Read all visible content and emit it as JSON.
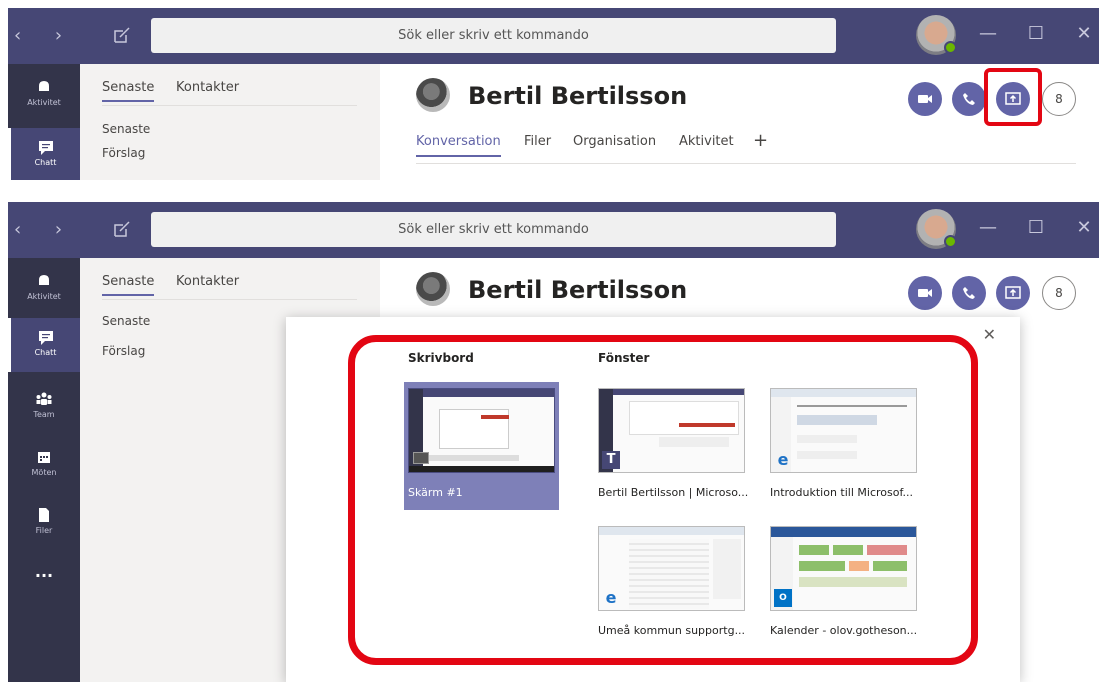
{
  "search": {
    "placeholder": "Sök eller skriv ett kommando"
  },
  "window_controls": {
    "minimize": "—",
    "maximize": "☐",
    "close": "✕"
  },
  "rail": {
    "activity_label": "Aktivitet",
    "chat_label": "Chatt",
    "teams_label": "Team",
    "meetings_label": "Möten",
    "files_label": "Filer",
    "more_label": "···"
  },
  "list": {
    "tabs": [
      "Senaste",
      "Kontakter"
    ],
    "items": [
      "Senaste",
      "Förslag"
    ]
  },
  "chat": {
    "name": "Bertil Bertilsson",
    "tabs": [
      "Konversation",
      "Filer",
      "Organisation",
      "Aktivitet"
    ],
    "add_tab": "+",
    "add_people": "8"
  },
  "share_dialog": {
    "close": "✕",
    "desktop_heading": "Skrivbord",
    "windows_heading": "Fönster",
    "desktop": {
      "label": "Skärm #1"
    },
    "windows": [
      {
        "label": "Bertil Bertilsson | Microso...",
        "app": "teams-icon"
      },
      {
        "label": "Introduktion till Microsof...",
        "app": "edge-icon"
      },
      {
        "label": "Umeå kommun supportg...",
        "app": "edge-icon"
      },
      {
        "label": "Kalender - olov.gotheson...",
        "app": "outlook-icon"
      }
    ]
  },
  "colors": {
    "accent": "#6264a7",
    "titlebar": "#464775",
    "rail": "#33344a",
    "highlight": "#e30613"
  }
}
